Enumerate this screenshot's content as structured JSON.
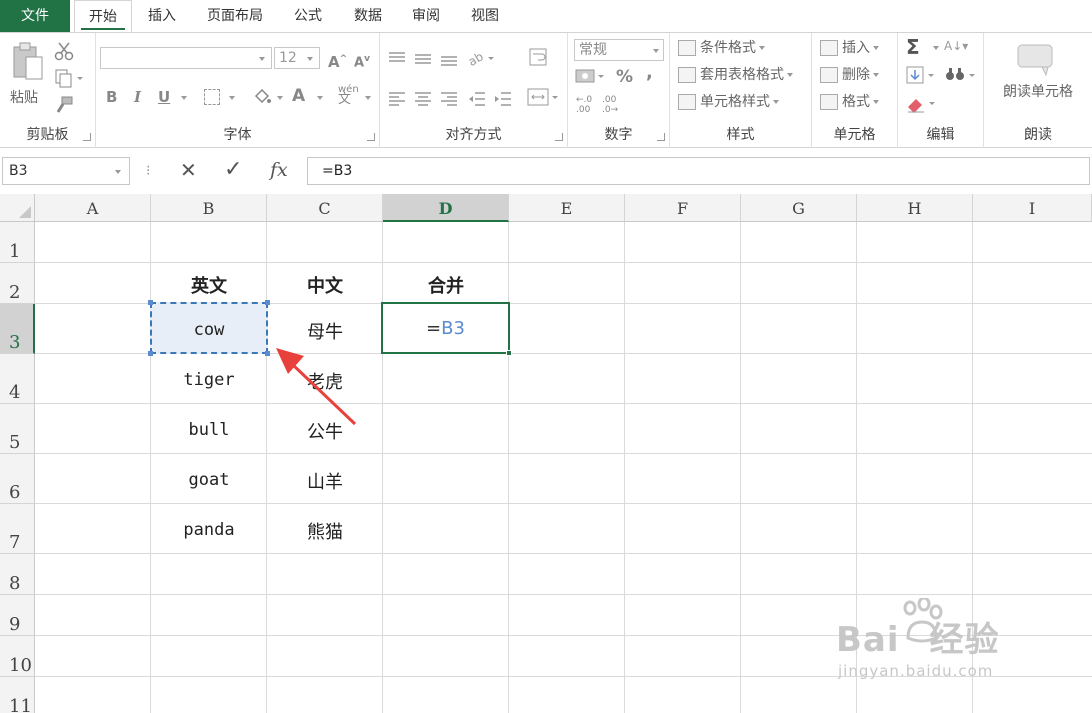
{
  "tabs": [
    "文件",
    "开始",
    "插入",
    "页面布局",
    "公式",
    "数据",
    "审阅",
    "视图"
  ],
  "ribbon": {
    "clipboard": {
      "paste": "粘贴",
      "label": "剪贴板"
    },
    "font": {
      "size": "12",
      "bold": "B",
      "italic": "I",
      "underline": "U",
      "font_color": "A",
      "phonetic": "wén",
      "label": "字体"
    },
    "alignment": {
      "label": "对齐方式"
    },
    "number": {
      "format": "常规",
      "percent": "%",
      "comma": ",",
      "inc_decimal": ".00",
      "dec_decimal": ".0",
      "label": "数字"
    },
    "styles": {
      "conditional": "条件格式",
      "table": "套用表格格式",
      "cell": "单元格样式",
      "label": "样式"
    },
    "cells": {
      "insert": "插入",
      "delete": "删除",
      "format": "格式",
      "label": "单元格"
    },
    "editing": {
      "sum": "Σ",
      "label": "编辑"
    },
    "read": {
      "button": "朗读单元格",
      "label": "朗读"
    }
  },
  "formula_bar": {
    "name_box": "B3",
    "cancel": "✕",
    "enter": "✓",
    "fx": "fx",
    "formula": "=B3"
  },
  "columns": [
    "A",
    "B",
    "C",
    "D",
    "E",
    "F",
    "G",
    "H",
    "I"
  ],
  "rows": [
    "1",
    "2",
    "3",
    "4",
    "5",
    "6",
    "7",
    "8",
    "9",
    "10",
    "11"
  ],
  "table": {
    "headers": {
      "b": "英文",
      "c": "中文",
      "d": "合并"
    },
    "rows": [
      {
        "en": "cow",
        "zh": "母牛"
      },
      {
        "en": "tiger",
        "zh": "老虎"
      },
      {
        "en": "bull",
        "zh": "公牛"
      },
      {
        "en": "goat",
        "zh": "山羊"
      },
      {
        "en": "panda",
        "zh": "熊猫"
      }
    ]
  },
  "active_cell": {
    "prefix": "=",
    "ref": "B3"
  },
  "annotation_color": "#e8413c",
  "accent_color": "#217346",
  "watermark": {
    "logo": "Baidu 经验",
    "url": "jingyan.baidu.com"
  }
}
